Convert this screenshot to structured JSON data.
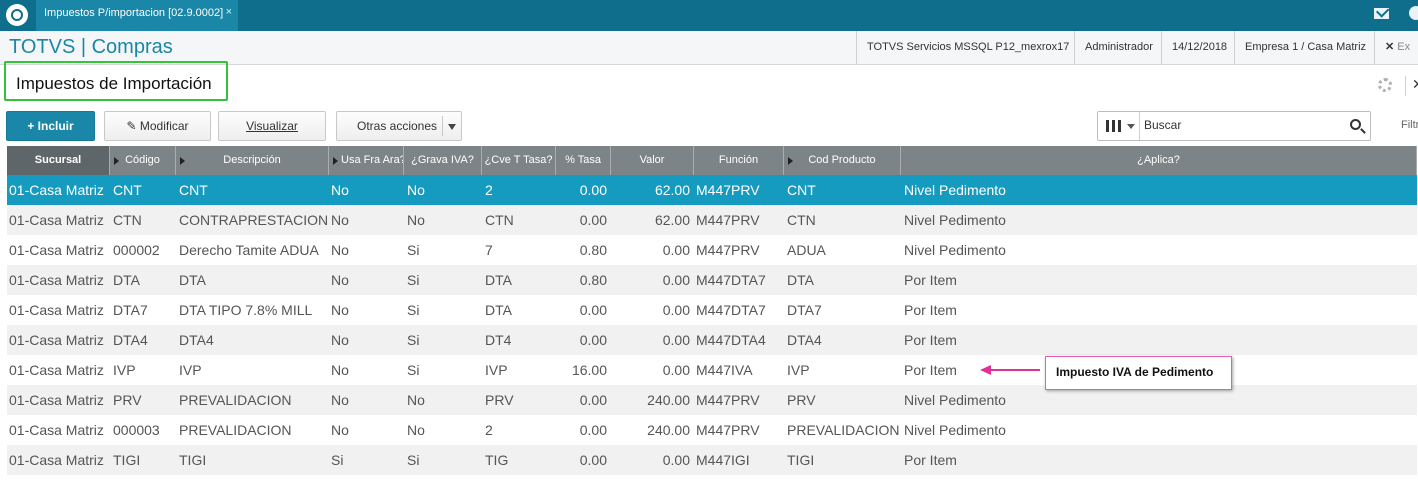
{
  "topbar": {
    "tab_title": "Impuestos P/importacion [02.9.0002]",
    "tab_close": "×"
  },
  "header": {
    "brand": "TOTVS | Compras",
    "server": "TOTVS Servicios MSSQL P12_mexrox17",
    "user": "Administrador",
    "date": "14/12/2018",
    "company": "Empresa 1 / Casa Matriz",
    "exit_label": "Ex"
  },
  "page": {
    "title": "Impuestos de Importación",
    "close": "✕"
  },
  "toolbar": {
    "incluir": "Incluir",
    "modificar": "Modificar",
    "visualizar": "Visualizar",
    "otras": "Otras acciones"
  },
  "search": {
    "placeholder": "Buscar",
    "filter_label": "Filtr"
  },
  "grid": {
    "columns": [
      "Sucursal",
      "Código",
      "Descripción",
      "Usa Fra Ara?",
      "¿Grava IVA?",
      "¿Cve T Tasa?",
      "% Tasa",
      "Valor",
      "Función",
      "Cod Producto",
      "¿Aplica?"
    ],
    "rows": [
      [
        "01-Casa Matriz",
        "CNT",
        "CNT",
        "No",
        "No",
        "2",
        "0.00",
        "62.00",
        "M447PRV",
        "CNT",
        "Nivel Pedimento"
      ],
      [
        "01-Casa Matriz",
        "CTN",
        "CONTRAPRESTACION",
        "No",
        "No",
        "CTN",
        "0.00",
        "62.00",
        "M447PRV",
        "CTN",
        "Nivel Pedimento"
      ],
      [
        "01-Casa Matriz",
        "000002",
        "Derecho Tamite ADUA",
        "No",
        "Si",
        "7",
        "0.80",
        "0.00",
        "M447PRV",
        "ADUA",
        "Nivel Pedimento"
      ],
      [
        "01-Casa Matriz",
        "DTA",
        "DTA",
        "No",
        "Si",
        "DTA",
        "0.80",
        "0.00",
        "M447DTA7",
        "DTA",
        "Por Item"
      ],
      [
        "01-Casa Matriz",
        "DTA7",
        "DTA TIPO 7.8% MILL",
        "No",
        "Si",
        "DTA",
        "0.00",
        "0.00",
        "M447DTA7",
        "DTA7",
        "Por Item"
      ],
      [
        "01-Casa Matriz",
        "DTA4",
        "DTA4",
        "No",
        "Si",
        "DT4",
        "0.00",
        "0.00",
        "M447DTA4",
        "DTA4",
        "Por Item"
      ],
      [
        "01-Casa Matriz",
        "IVP",
        "IVP",
        "No",
        "Si",
        "IVP",
        "16.00",
        "0.00",
        "M447IVA",
        "IVP",
        "Por Item"
      ],
      [
        "01-Casa Matriz",
        "PRV",
        "PREVALIDACION",
        "No",
        "No",
        "PRV",
        "0.00",
        "240.00",
        "M447PRV",
        "PRV",
        "Nivel Pedimento"
      ],
      [
        "01-Casa Matriz",
        "000003",
        "PREVALIDACION",
        "No",
        "No",
        "2",
        "0.00",
        "240.00",
        "M447PRV",
        "PREVALIDACION",
        "Nivel Pedimento"
      ],
      [
        "01-Casa Matriz",
        "TIGI",
        "TIGI",
        "Si",
        "Si",
        "TIG",
        "0.00",
        "0.00",
        "M447IGI",
        "TIGI",
        "Por Item"
      ]
    ]
  },
  "annotation": {
    "text": "Impuesto IVA de Pedimento",
    "color": "#e0309a"
  },
  "colors": {
    "accent": "#1a87a8",
    "selected_row": "#169bc0",
    "title_outline": "#35c33a"
  }
}
